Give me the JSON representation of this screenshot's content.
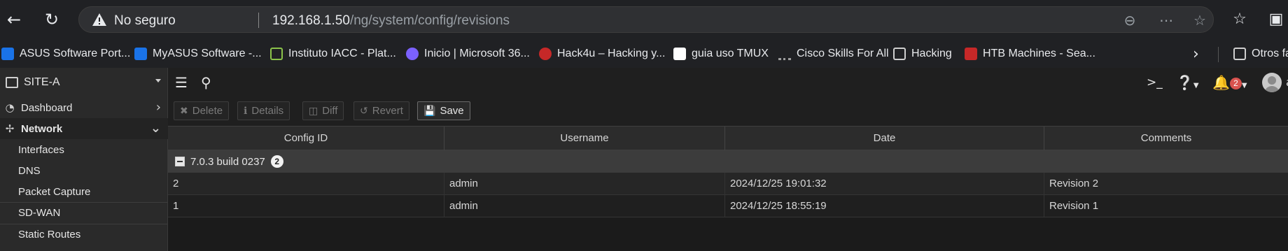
{
  "browser": {
    "security_label": "No seguro",
    "url_host": "192.168.1.50",
    "url_path": "/ng/system/config/revisions",
    "icons": {
      "back": "back-arrow-icon",
      "reload": "reload-icon",
      "zoom": "zoom-out-icon",
      "more": "more-icon",
      "favorite": "star-icon",
      "favorites_list": "favorites-list-icon"
    }
  },
  "bookmarks": [
    {
      "label": "ASUS Software Port...",
      "color": "#1a73e8"
    },
    {
      "label": "MyASUS Software -...",
      "color": "#1a73e8"
    },
    {
      "label": "Instituto IACC - Plat...",
      "color": "#8bc34a"
    },
    {
      "label": "Inicio | Microsoft 36...",
      "color": "#7b61ff"
    },
    {
      "label": "Hack4u – Hacking y...",
      "color": "#c62828"
    },
    {
      "label": "guia uso TMUX",
      "color": "#ffffff"
    },
    {
      "label": "Cisco Skills For All",
      "color": "#9e9e9e"
    },
    {
      "label": "Hacking",
      "color": "#cfcfcf"
    },
    {
      "label": "HTB Machines - Sea...",
      "color": "#c62828"
    }
  ],
  "bookmarks_overflow": "Otros fa",
  "sidebar": {
    "device": "SITE-A",
    "items": [
      {
        "label": "Dashboard",
        "icon": "dashboard-icon"
      },
      {
        "label": "Network",
        "icon": "network-icon"
      }
    ],
    "network_sub": [
      "Interfaces",
      "DNS",
      "Packet Capture",
      "SD-WAN",
      "Static Routes"
    ]
  },
  "topbar": {
    "alerts_count": "2",
    "user_initial": "a"
  },
  "toolbar": {
    "delete": "Delete",
    "details": "Details",
    "diff": "Diff",
    "revert": "Revert",
    "save": "Save"
  },
  "table": {
    "columns": [
      "Config ID",
      "Username",
      "Date",
      "Comments"
    ],
    "group": {
      "label": "7.0.3 build 0237",
      "count": "2"
    },
    "rows": [
      {
        "id": "2",
        "username": "admin",
        "date": "2024/12/25 19:01:32",
        "comment": "Revision 2"
      },
      {
        "id": "1",
        "username": "admin",
        "date": "2024/12/25 18:55:19",
        "comment": "Revision 1"
      }
    ]
  }
}
